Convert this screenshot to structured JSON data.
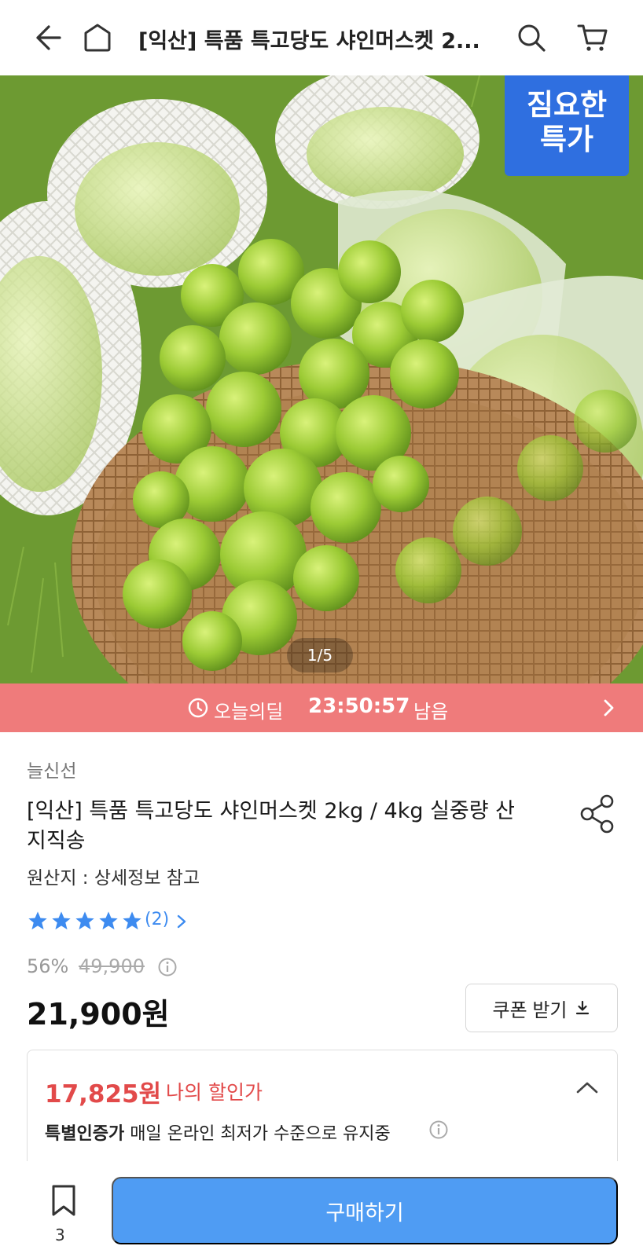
{
  "header": {
    "title": "[익산] 특품  특고당도 샤인머스켓 2...",
    "icons": [
      "back-arrow-icon",
      "home-icon",
      "search-icon",
      "cart-icon"
    ]
  },
  "hero": {
    "badge_line1": "짐요한",
    "badge_line2": "특가",
    "pager": "1/5",
    "badge_color": "#2f6fe0"
  },
  "deal": {
    "label": "오늘의딜",
    "time": "23:50:57",
    "remain": "남음",
    "color": "#ef7b7b"
  },
  "product": {
    "brand": "늘신선",
    "title": "[익산] 특품  특고당도 샤인머스켓 2kg / 4kg 실중량 산지직송",
    "origin": "원산지 : 상세정보 참고",
    "rating_stars": 5,
    "review_count": "(2)",
    "discount_rate": "56%",
    "original_price": "49,900",
    "price": "21,900원",
    "coupon_label": "쿠폰 받기"
  },
  "my_price_box": {
    "price": "17,825원",
    "label": "나의 할인가",
    "cert_bold": "특별인증가",
    "cert_text": " 매일 온라인 최저가 수준으로 유지중"
  },
  "bottom_bar": {
    "bookmark_count": "3",
    "buy_label": "구매하기",
    "buy_color": "#4f9cf3"
  }
}
